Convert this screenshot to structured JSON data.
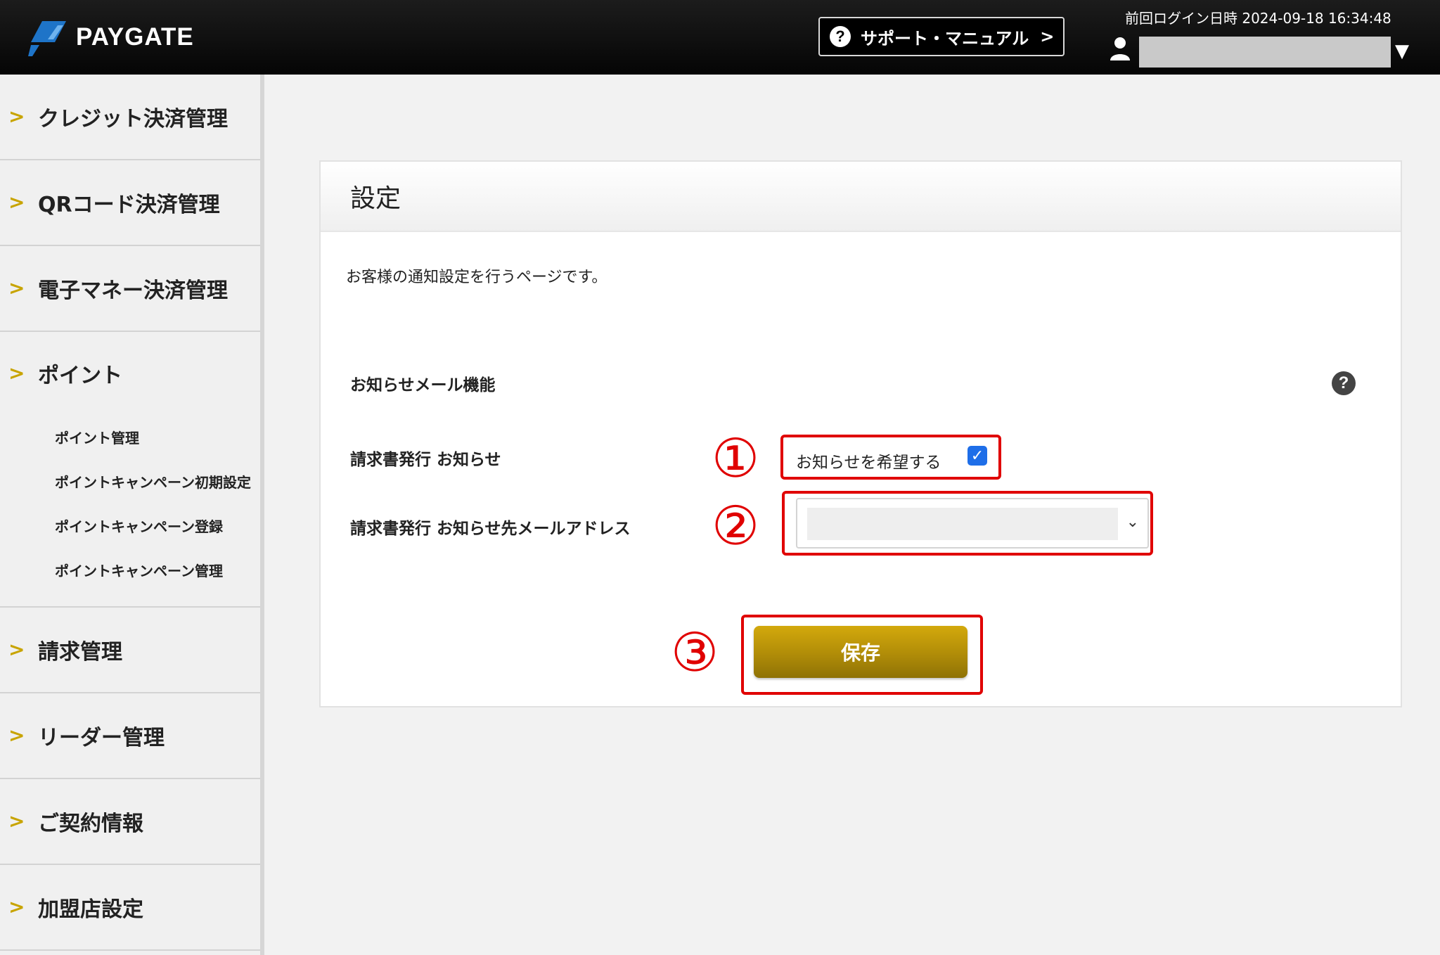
{
  "header": {
    "brand": "PAYGATE",
    "support_label": "サポート・マニュアル",
    "support_chevron": ">",
    "last_login": "前回ログイン日時 2024-09-18 16:34:48",
    "user_caret": "▼",
    "brand_color": "#1e74c8"
  },
  "sidebar": {
    "chevron": ">",
    "items": [
      {
        "label": "クレジット決済管理"
      },
      {
        "label": "QRコード決済管理"
      },
      {
        "label": "電子マネー決済管理"
      },
      {
        "label": "ポイント",
        "children": [
          {
            "label": "ポイント管理"
          },
          {
            "label": "ポイントキャンペーン初期設定"
          },
          {
            "label": "ポイントキャンペーン登録"
          },
          {
            "label": "ポイントキャンペーン管理"
          }
        ]
      },
      {
        "label": "請求管理"
      },
      {
        "label": "リーダー管理"
      },
      {
        "label": "ご契約情報"
      },
      {
        "label": "加盟店設定"
      }
    ]
  },
  "main": {
    "title": "設定",
    "description": "お客様の通知設定を行うページです。",
    "section_label": "お知らせメール機能",
    "notice_label": "請求書発行 お知らせ",
    "notice_checkbox_label": "お知らせを希望する",
    "notice_checked": true,
    "email_label": "請求書発行 お知らせ先メールアドレス",
    "save_label": "保存",
    "annotations": [
      "①",
      "②",
      "③"
    ],
    "accent_color": "#e00000",
    "button_color": "#b08c08"
  }
}
